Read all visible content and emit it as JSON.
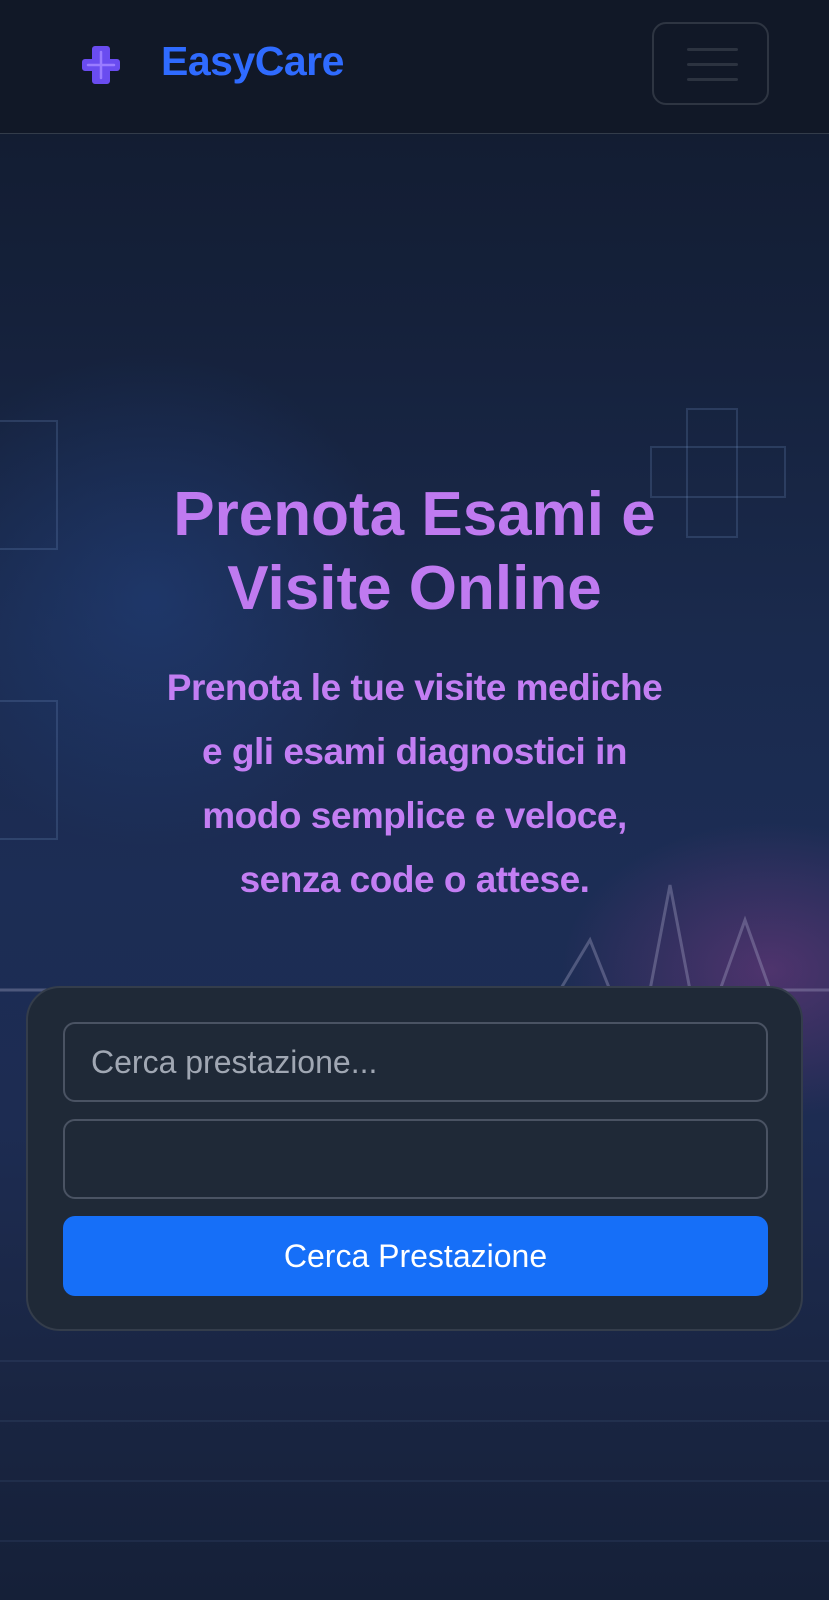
{
  "header": {
    "brand": "EasyCare",
    "menu_label": "Toggle navigation"
  },
  "hero": {
    "title_line1": "Prenota Esami e",
    "title_line2": "Visite Online",
    "subtitle_lines": [
      "Prenota le tue visite mediche",
      "e gli esami diagnostici in",
      "modo semplice e veloce,",
      "senza code o attese."
    ]
  },
  "search": {
    "service_placeholder": "Cerca prestazione...",
    "service_value": "",
    "location_placeholder": "",
    "location_value": "",
    "button_label": "Cerca Prestazione"
  },
  "colors": {
    "header_bg": "#111827",
    "brand": "#2f6bff",
    "logo": "#6a4cf0",
    "hero_text": "#bf7af0",
    "card_bg": "#1f2937",
    "button_bg": "#166ff8",
    "button_text": "#ffffff"
  },
  "icons": {
    "logo": "medical-cross-icon",
    "menu": "hamburger-menu-icon"
  }
}
